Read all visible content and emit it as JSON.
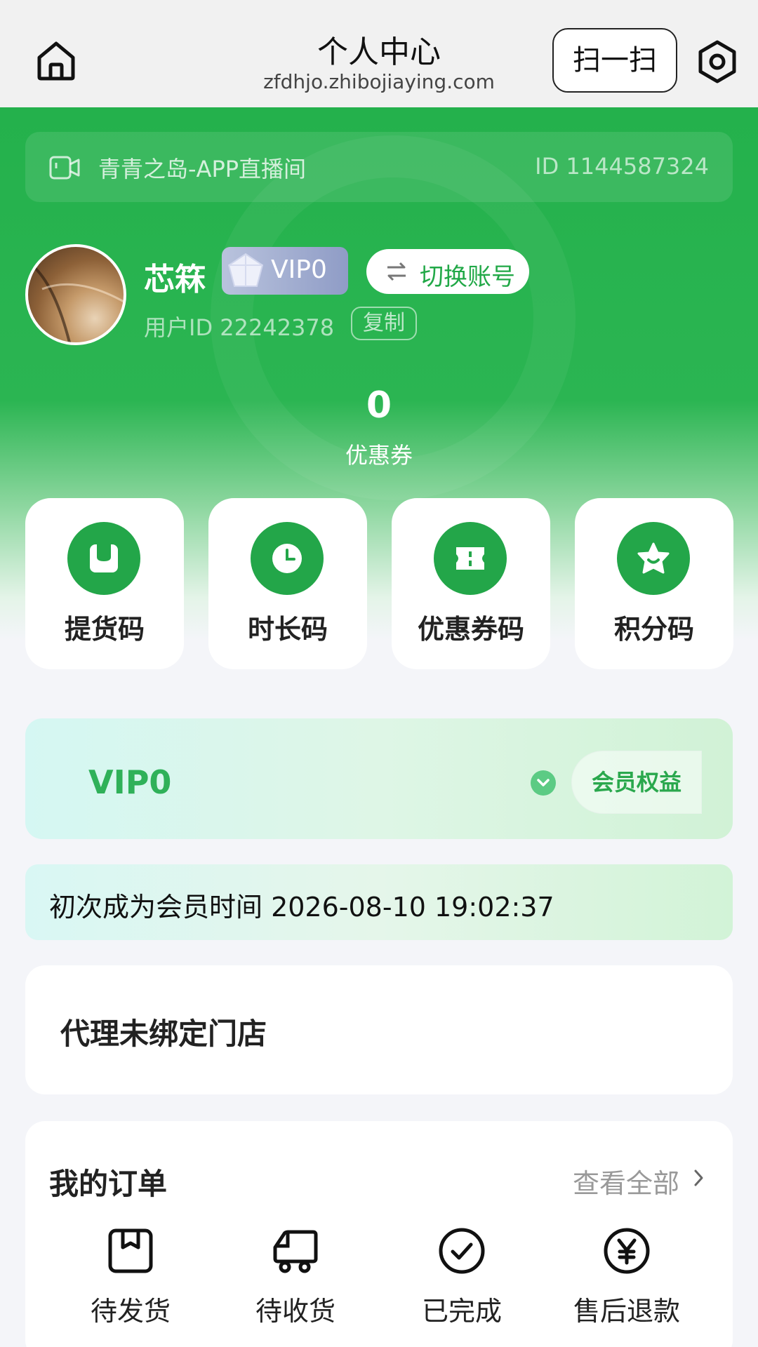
{
  "header": {
    "title": "个人中心",
    "subtitle": "zfdhjo.zhibojiaying.com",
    "scan_label": "扫一扫"
  },
  "room": {
    "name": "青青之岛-APP直播间",
    "id": "ID 1144587324"
  },
  "profile": {
    "nickname": "芯箖",
    "vip_badge": "VIP0",
    "switch_label": "切换账号",
    "user_id": "用户ID 22242378",
    "copy_label": "复制"
  },
  "coupon": {
    "count": "0",
    "label": "优惠券"
  },
  "codes": [
    {
      "label": "提货码",
      "icon": "bag-icon"
    },
    {
      "label": "时长码",
      "icon": "clock-icon"
    },
    {
      "label": "优惠券码",
      "icon": "ticket-icon"
    },
    {
      "label": "积分码",
      "icon": "star-icon"
    }
  ],
  "vip": {
    "level": "VIP0",
    "benefit_label": "会员权益",
    "member_since": "初次成为会员时间 2026-08-10 19:02:37"
  },
  "agent": {
    "text": "代理未绑定门店"
  },
  "orders": {
    "title": "我的订单",
    "view_all": "查看全部",
    "items": [
      {
        "label": "待发货",
        "icon": "package-icon"
      },
      {
        "label": "待收货",
        "icon": "truck-icon"
      },
      {
        "label": "已完成",
        "icon": "check-circle-icon"
      },
      {
        "label": "售后退款",
        "icon": "yuan-icon"
      }
    ]
  },
  "colors": {
    "brand_green": "#23a649",
    "header_bg": "#f1f1f1",
    "page_bg": "#f4f5f9"
  }
}
